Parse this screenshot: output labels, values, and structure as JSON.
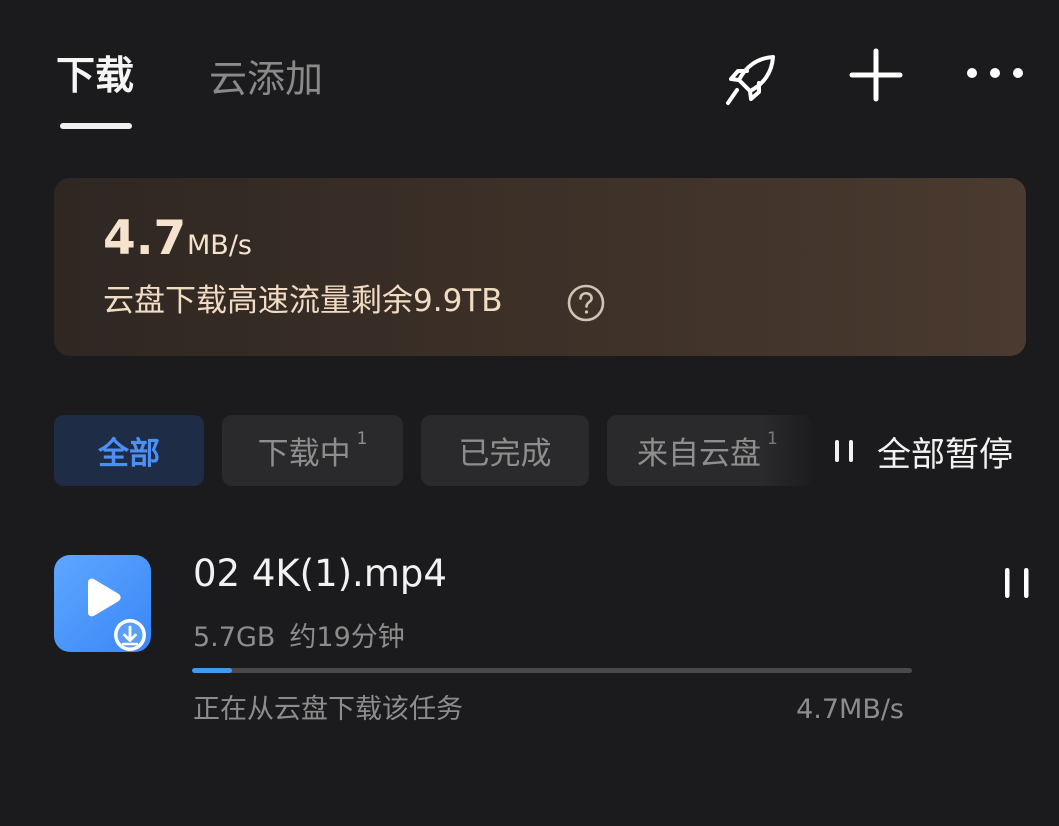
{
  "header": {
    "tabs": [
      {
        "label": "下载",
        "active": true
      },
      {
        "label": "云添加",
        "active": false
      }
    ],
    "icons": [
      "rocket-icon",
      "plus-icon",
      "more-icon"
    ]
  },
  "speed_banner": {
    "value": "4.7",
    "unit": "MB/s",
    "quota_text": "云盘下载高速流量剩余9.9TB",
    "help_icon": "question-circle-icon"
  },
  "filters": {
    "chips": [
      {
        "label": "全部",
        "count": "",
        "active": true
      },
      {
        "label": "下载中",
        "count": "1",
        "active": false
      },
      {
        "label": "已完成",
        "count": "",
        "active": false
      },
      {
        "label": "来自云盘",
        "count": "1",
        "active": false
      }
    ],
    "pause_all_label": "全部暂停"
  },
  "tasks": [
    {
      "file_name": "02 4K(1).mp4",
      "size": "5.7GB",
      "eta": "约19分钟",
      "progress": 0.055,
      "status": "正在从云盘下载该任务",
      "speed": "4.7MB/s",
      "icon": "video-file-icon"
    }
  ],
  "colors": {
    "background": "#1b1b1d",
    "accent": "#4c8ff5",
    "progress": "#3d9af0",
    "banner_text": "#f6e3cd"
  }
}
